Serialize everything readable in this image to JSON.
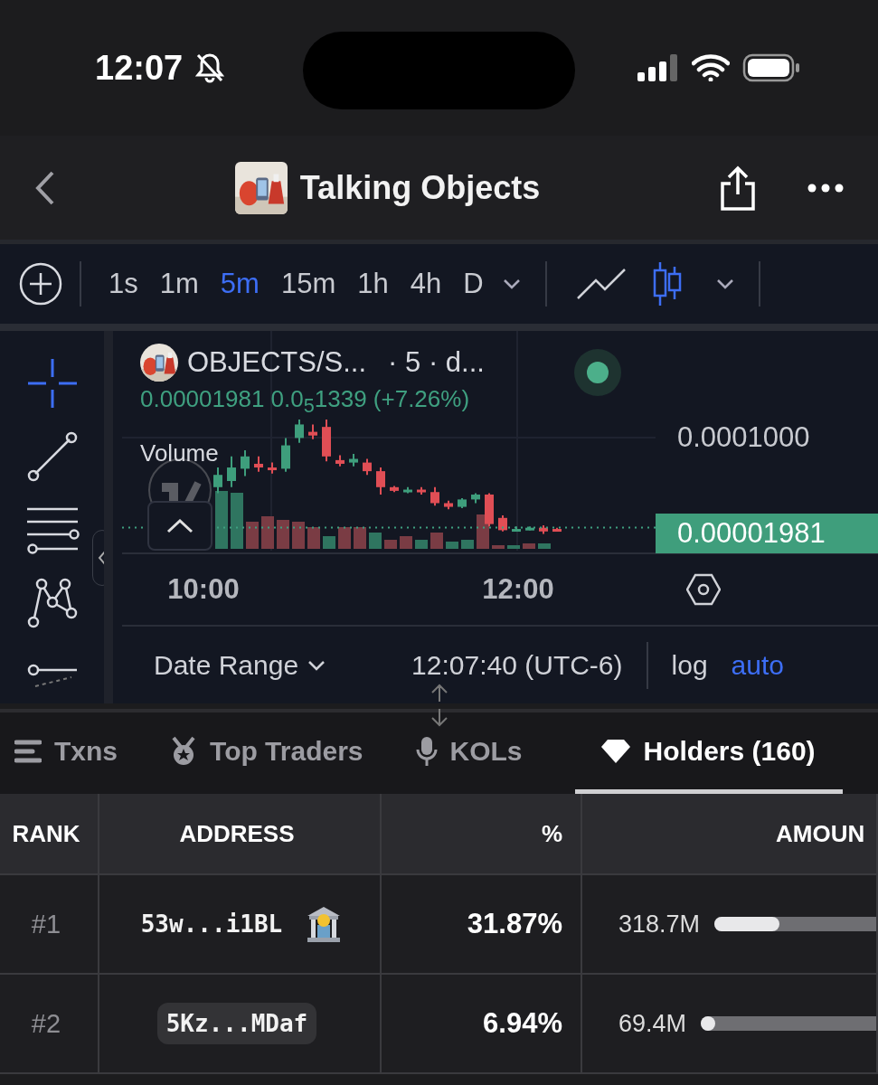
{
  "status_bar": {
    "time": "12:07",
    "muted": true
  },
  "nav": {
    "title": "Talking Objects"
  },
  "toolbar": {
    "timeframes": [
      {
        "label": "1s",
        "selected": false
      },
      {
        "label": "1m",
        "selected": false
      },
      {
        "label": "5m",
        "selected": true
      },
      {
        "label": "15m",
        "selected": false
      },
      {
        "label": "1h",
        "selected": false
      },
      {
        "label": "4h",
        "selected": false
      },
      {
        "label": "D",
        "selected": false
      }
    ],
    "chart_types": [
      {
        "kind": "line",
        "selected": false
      },
      {
        "kind": "candles",
        "selected": true
      }
    ]
  },
  "drawing_tools": [
    {
      "kind": "crosshair",
      "selected": true
    },
    {
      "kind": "trend",
      "selected": false
    },
    {
      "kind": "lines",
      "selected": false
    },
    {
      "kind": "pattern",
      "selected": false
    },
    {
      "kind": "partial",
      "selected": false
    }
  ],
  "chart": {
    "symbol": "OBJECTS/S...",
    "interval": "· 5 · d...",
    "live": true,
    "values": "0.00001981 0.0$_{5}$1339 (+7.26%)",
    "volume_label": "Volume",
    "price_tick": "0.0001000",
    "last_price": "0.00001981",
    "time_ticks": [
      "10:00",
      "12:00"
    ]
  },
  "chart_footer": {
    "date_range": "Date Range",
    "clock": "12:07:40 (UTC-6)",
    "scales": [
      {
        "label": "log",
        "selected": false
      },
      {
        "label": "auto",
        "selected": true
      }
    ]
  },
  "tabs": [
    {
      "kind": "txns",
      "label": "Txns",
      "selected": false
    },
    {
      "kind": "traders",
      "label": "Top Traders",
      "selected": false
    },
    {
      "kind": "kols",
      "label": "KOLs",
      "selected": false
    },
    {
      "kind": "holders",
      "label": "Holders (160)",
      "selected": true
    }
  ],
  "table": {
    "columns": [
      "RANK",
      "ADDRESS",
      "%",
      "AMOUN"
    ],
    "rows": [
      {
        "rank": "#1",
        "address": "53w...i1BL",
        "tagged": true,
        "highlighted": false,
        "percent": "31.87%",
        "amount": "318.7M",
        "level": 0.18
      },
      {
        "rank": "#2",
        "address": "5Kz...MDaf",
        "tagged": false,
        "highlighted": true,
        "percent": "6.94%",
        "amount": "69.4M",
        "level": 0.03
      }
    ]
  }
}
